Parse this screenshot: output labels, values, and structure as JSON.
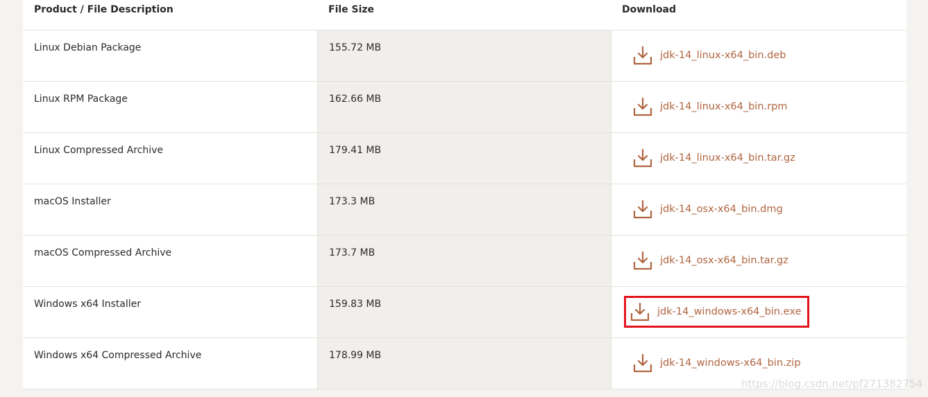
{
  "table": {
    "headers": {
      "product": "Product / File Description",
      "size": "File Size",
      "download": "Download"
    },
    "rows": [
      {
        "product": "Linux Debian Package",
        "size": "155.72 MB",
        "file": "jdk-14_linux-x64_bin.deb"
      },
      {
        "product": "Linux RPM Package",
        "size": "162.66 MB",
        "file": "jdk-14_linux-x64_bin.rpm"
      },
      {
        "product": "Linux Compressed Archive",
        "size": "179.41 MB",
        "file": "jdk-14_linux-x64_bin.tar.gz"
      },
      {
        "product": "macOS Installer",
        "size": "173.3 MB",
        "file": "jdk-14_osx-x64_bin.dmg"
      },
      {
        "product": "macOS Compressed Archive",
        "size": "173.7 MB",
        "file": "jdk-14_osx-x64_bin.tar.gz"
      },
      {
        "product": "Windows x64 Installer",
        "size": "159.83 MB",
        "file": "jdk-14_windows-x64_bin.exe"
      },
      {
        "product": "Windows x64 Compressed Archive",
        "size": "178.99 MB",
        "file": "jdk-14_windows-x64_bin.zip"
      }
    ]
  },
  "colors": {
    "link": "#b0643f",
    "highlight": "#e3131b",
    "size_column_bg": "#f1efeb"
  },
  "icons": {
    "download": "download-icon"
  },
  "watermark": "https://blog.csdn.net/pf271382754"
}
